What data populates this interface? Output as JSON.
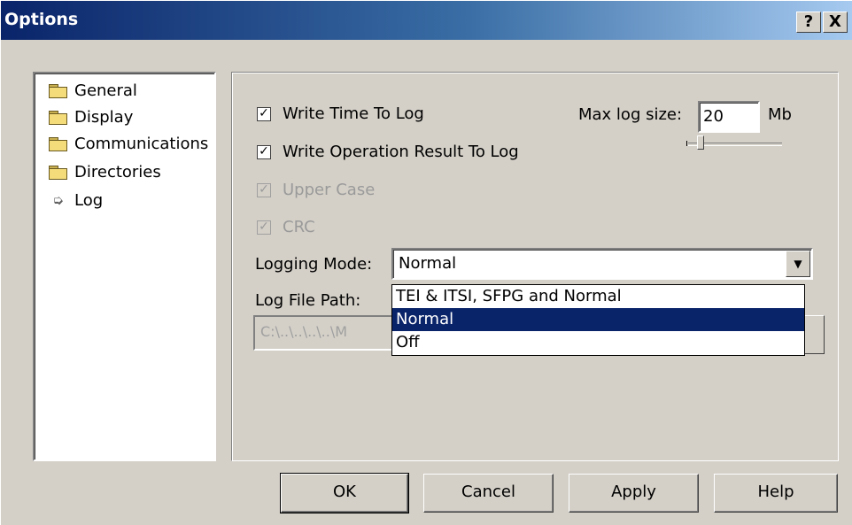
{
  "window": {
    "title": "Options",
    "help_button": "?",
    "close_button": "X"
  },
  "tree": {
    "items": [
      {
        "label": "General",
        "icon": "folder-icon"
      },
      {
        "label": "Display",
        "icon": "folder-icon"
      },
      {
        "label": "Communications",
        "icon": "folder-icon"
      },
      {
        "label": "Directories",
        "icon": "folder-icon"
      },
      {
        "label": "Log",
        "icon": "arrow-icon"
      }
    ]
  },
  "log": {
    "write_time_label": "Write Time To Log",
    "write_time_checked": true,
    "write_result_label": "Write Operation Result To Log",
    "write_result_checked": true,
    "upper_case_label": "Upper Case",
    "upper_case_checked": true,
    "crc_label": "CRC",
    "crc_checked": true,
    "max_log_label": "Max log size:",
    "max_log_value": "20",
    "max_log_unit": "Mb",
    "logging_mode_label": "Logging Mode:",
    "logging_mode_value": "Normal",
    "logging_mode_options": [
      "TEI & ITSI, SFPG and Normal",
      "Normal",
      "Off"
    ],
    "log_file_path_label": "Log File Path:",
    "log_file_path_value": "C:\\..\\..\\..\\..\\M"
  },
  "buttons": {
    "ok": "OK",
    "cancel": "Cancel",
    "apply": "Apply",
    "help": "Help"
  }
}
